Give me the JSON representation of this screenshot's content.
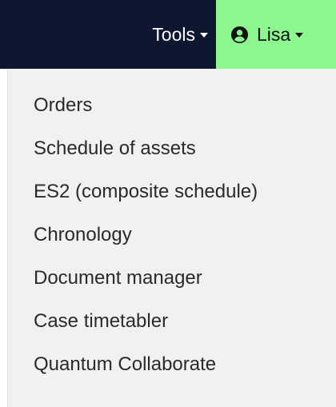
{
  "navbar": {
    "tools_label": "Tools",
    "user_label": "Lisa",
    "user_icon": "user-circle-icon",
    "colors": {
      "navbar_bg": "#0d1730",
      "user_bg": "#8df78f"
    }
  },
  "dropdown": {
    "items": [
      {
        "label": "Orders"
      },
      {
        "label": "Schedule of assets"
      },
      {
        "label": "ES2 (composite schedule)"
      },
      {
        "label": "Chronology"
      },
      {
        "label": "Document manager"
      },
      {
        "label": "Case timetabler"
      },
      {
        "label": "Quantum Collaborate"
      }
    ]
  }
}
